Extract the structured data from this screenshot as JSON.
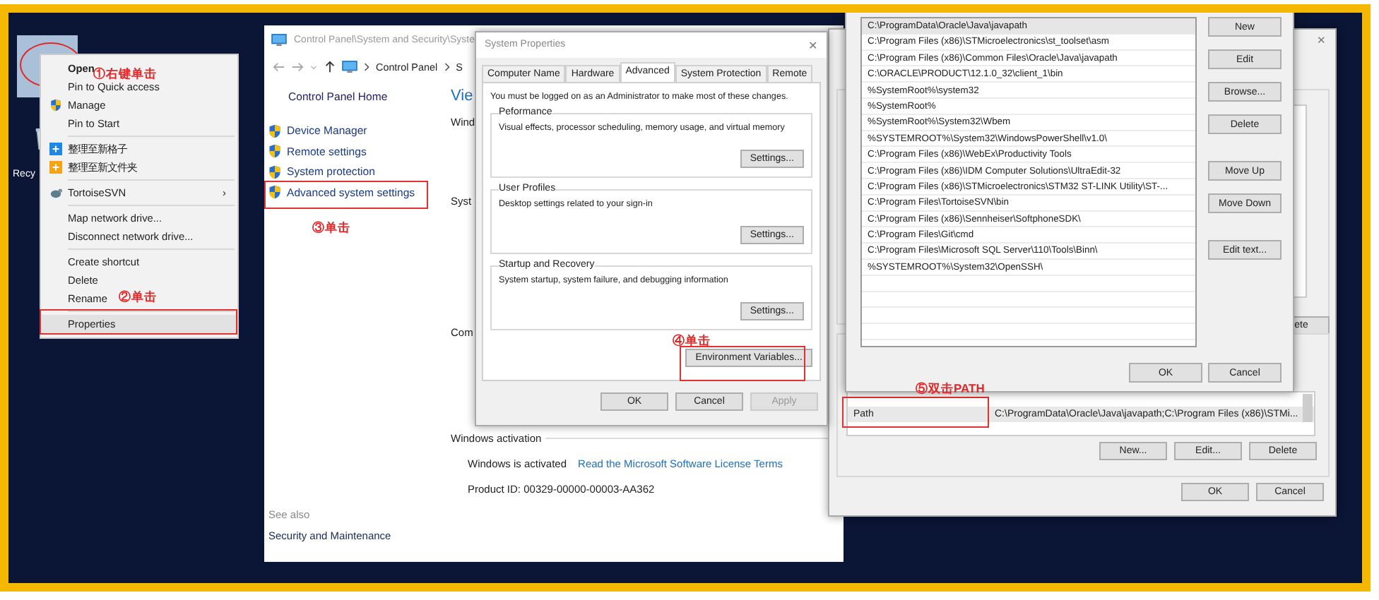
{
  "desktop": {
    "icons": [
      {
        "label": "Recy"
      }
    ]
  },
  "context_menu": {
    "items": [
      {
        "kind": "plain",
        "label": "Open",
        "default": true,
        "selected": false
      },
      {
        "kind": "plain",
        "label": "Pin to Quick access",
        "default": false,
        "selected": false
      },
      {
        "kind": "shield",
        "label": "Manage",
        "default": false,
        "selected": false
      },
      {
        "kind": "plain",
        "label": "Pin to Start",
        "default": false,
        "selected": false
      },
      {
        "kind": "separator"
      },
      {
        "kind": "tile",
        "label": "整理至新格子",
        "default": false,
        "selected": false
      },
      {
        "kind": "folder",
        "label": "整理至新文件夹",
        "default": false,
        "selected": false
      },
      {
        "kind": "separator"
      },
      {
        "kind": "submenu",
        "label": "TortoiseSVN",
        "arrow": "›",
        "default": false,
        "selected": false
      },
      {
        "kind": "separator"
      },
      {
        "kind": "plain",
        "label": "Map network drive...",
        "default": false,
        "selected": false
      },
      {
        "kind": "plain",
        "label": "Disconnect network drive...",
        "default": false,
        "selected": false
      },
      {
        "kind": "separator"
      },
      {
        "kind": "plain",
        "label": "Create shortcut",
        "default": false,
        "selected": false
      },
      {
        "kind": "plain",
        "label": "Delete",
        "default": false,
        "selected": false
      },
      {
        "kind": "plain",
        "label": "Rename",
        "default": false,
        "selected": false
      },
      {
        "kind": "separator"
      },
      {
        "kind": "plain",
        "label": "Properties",
        "default": false,
        "selected": true
      }
    ]
  },
  "annotations": [
    {
      "text": "①右键单击"
    },
    {
      "text": "②单击"
    },
    {
      "text": "③单击"
    },
    {
      "text": "④单击"
    },
    {
      "text": "⑤双击PATH"
    }
  ],
  "control_panel": {
    "title": "Control Panel\\System and Security\\Syste",
    "breadcrumb": [
      "Control Panel",
      "S"
    ],
    "home": "Control Panel Home",
    "tasks": [
      "Device Manager",
      "Remote settings",
      "System protection",
      "Advanced system settings"
    ],
    "headings": [
      "Vie",
      "Wind",
      "Syst",
      "Com"
    ],
    "activation": {
      "heading": "Windows activation",
      "status": "Windows is activated",
      "link": "Read the Microsoft Software License Terms",
      "product_id": "Product ID:  00329-00000-00003-AA362"
    },
    "see_also": {
      "heading": "See also",
      "link": "Security and Maintenance"
    }
  },
  "system_properties": {
    "title": "System Properties",
    "close": "✕",
    "tabs": [
      {
        "label": "Computer Name",
        "selected": false
      },
      {
        "label": "Hardware",
        "selected": false
      },
      {
        "label": "Advanced",
        "selected": true
      },
      {
        "label": "System Protection",
        "selected": false
      },
      {
        "label": "Remote",
        "selected": false
      }
    ],
    "notice": "You must be logged on as an Administrator to make most of these changes.",
    "groups": [
      {
        "title": "Peformance",
        "description": "Visual effects, processor scheduling, memory usage, and virtual memory",
        "button": "Settings..."
      },
      {
        "title": "User Profiles",
        "description": "Desktop settings related to your sign-in",
        "button": "Settings..."
      },
      {
        "title": "Startup and Recovery",
        "description": "System startup, system failure, and debugging information",
        "button": "Settings..."
      }
    ],
    "env_button": "Environment Variables...",
    "buttons": [
      {
        "label": "OK",
        "disabled": false
      },
      {
        "label": "Cancel",
        "disabled": false
      },
      {
        "label": "Apply",
        "disabled": true
      }
    ]
  },
  "environment_variables": {
    "close": "✕",
    "partial_button": "ete",
    "system_rows": [
      {
        "name": "Path",
        "value": "C:\\ProgramData\\Oracle\\Java\\javapath;C:\\Program Files (x86)\\STMi...",
        "selected": true
      }
    ],
    "buttons": [
      "New...",
      "Edit...",
      "Delete"
    ],
    "dialog_buttons": [
      "OK",
      "Cancel"
    ]
  },
  "edit_dialog": {
    "paths": [
      {
        "text": "C:\\ProgramData\\Oracle\\Java\\javapath",
        "selected": true
      },
      {
        "text": "C:\\Program Files (x86)\\STMicroelectronics\\st_toolset\\asm",
        "selected": false
      },
      {
        "text": "C:\\Program Files (x86)\\Common Files\\Oracle\\Java\\javapath",
        "selected": false
      },
      {
        "text": "C:\\ORACLE\\PRODUCT\\12.1.0_32\\client_1\\bin",
        "selected": false
      },
      {
        "text": "%SystemRoot%\\system32",
        "selected": false
      },
      {
        "text": "%SystemRoot%",
        "selected": false
      },
      {
        "text": "%SystemRoot%\\System32\\Wbem",
        "selected": false
      },
      {
        "text": "%SYSTEMROOT%\\System32\\WindowsPowerShell\\v1.0\\",
        "selected": false
      },
      {
        "text": "C:\\Program Files (x86)\\WebEx\\Productivity Tools",
        "selected": false
      },
      {
        "text": "C:\\Program Files (x86)\\IDM Computer Solutions\\UltraEdit-32",
        "selected": false
      },
      {
        "text": "C:\\Program Files (x86)\\STMicroelectronics\\STM32 ST-LINK Utility\\ST-...",
        "selected": false
      },
      {
        "text": "C:\\Program Files\\TortoiseSVN\\bin",
        "selected": false
      },
      {
        "text": "C:\\Program Files (x86)\\Sennheiser\\SoftphoneSDK\\",
        "selected": false
      },
      {
        "text": "C:\\Program Files\\Git\\cmd",
        "selected": false
      },
      {
        "text": "C:\\Program Files\\Microsoft SQL Server\\110\\Tools\\Binn\\",
        "selected": false
      },
      {
        "text": "%SYSTEMROOT%\\System32\\OpenSSH\\",
        "selected": false
      }
    ],
    "side_buttons": [
      "New",
      "Edit",
      "Browse...",
      "Delete",
      "Move Up",
      "Move Down",
      "Edit text..."
    ],
    "buttons": [
      "OK",
      "Cancel"
    ]
  }
}
